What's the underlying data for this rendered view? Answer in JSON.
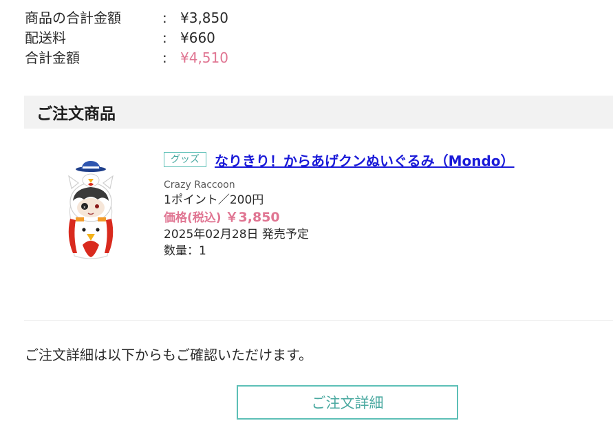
{
  "summary": {
    "rows": [
      {
        "label": "商品の合計金額",
        "colon": ":",
        "value": "¥3,850"
      },
      {
        "label": "配送料",
        "colon": ":",
        "value": "¥660"
      },
      {
        "label": "合計金額",
        "colon": ":",
        "value": "¥4,510"
      }
    ]
  },
  "order_section": {
    "title": "ご注文商品"
  },
  "product": {
    "category": "グッズ",
    "title": "なりきり！からあげクンぬいぐるみ（Mondo）",
    "brand": "Crazy Raccoon",
    "points": "1ポイント／200円",
    "price_label": "価格(税込)",
    "price_value": "￥3,850",
    "release": "2025年02月28日 発売予定",
    "quantity": "数量：1",
    "image_name": "plush-mascot-image"
  },
  "details": {
    "text": "ご注文詳細は以下からもご確認いただけます。",
    "button_label": "ご注文詳細"
  },
  "colors": {
    "accent_teal": "#5cbfb6",
    "price_pink": "#e07592",
    "link_blue": "#1a1ad8"
  }
}
